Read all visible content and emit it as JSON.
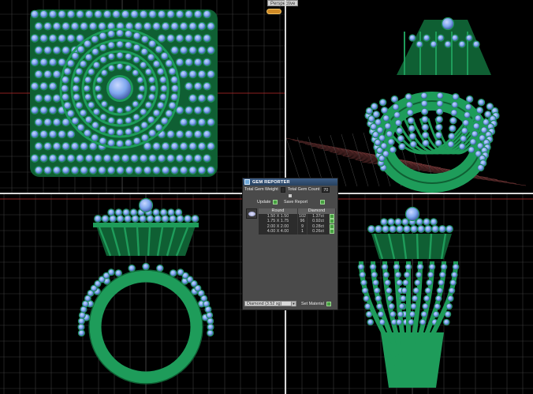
{
  "viewports": {
    "top_label": "",
    "perspective_label": "Perspective",
    "front_label": "",
    "right_label": ""
  },
  "gem_reporter": {
    "title": "GEM REPORTER",
    "total_weight_label": "Total Gem Weight",
    "total_weight_value": "",
    "total_count_label": "Total Gem Count",
    "total_count_value": "70",
    "update_label": "Update",
    "save_report_label": "Save Report",
    "shape_header": "Round",
    "material_header": "Diamond",
    "rows": [
      {
        "size": "1.50 X 1.50",
        "count": "102",
        "ct": "1.37ct"
      },
      {
        "size": "1.75 X 1.75",
        "count": "96",
        "ct": "0.92ct"
      },
      {
        "size": "2.00 X 2.00",
        "count": "9",
        "ct": "0.28ct"
      },
      {
        "size": "4.00 X 4.00",
        "count": "1",
        "ct": "0.26ct"
      }
    ],
    "material_select": "Diamond   (3.52 sg)",
    "set_material_label": "Set Material"
  },
  "colors": {
    "metal": "#1e9c5a",
    "metal_dark": "#0f5f33",
    "gem": "#7fa8ef",
    "gem_light": "#c9d8ff",
    "grid": "#3a3a3a",
    "axis_red": "#b22222"
  }
}
